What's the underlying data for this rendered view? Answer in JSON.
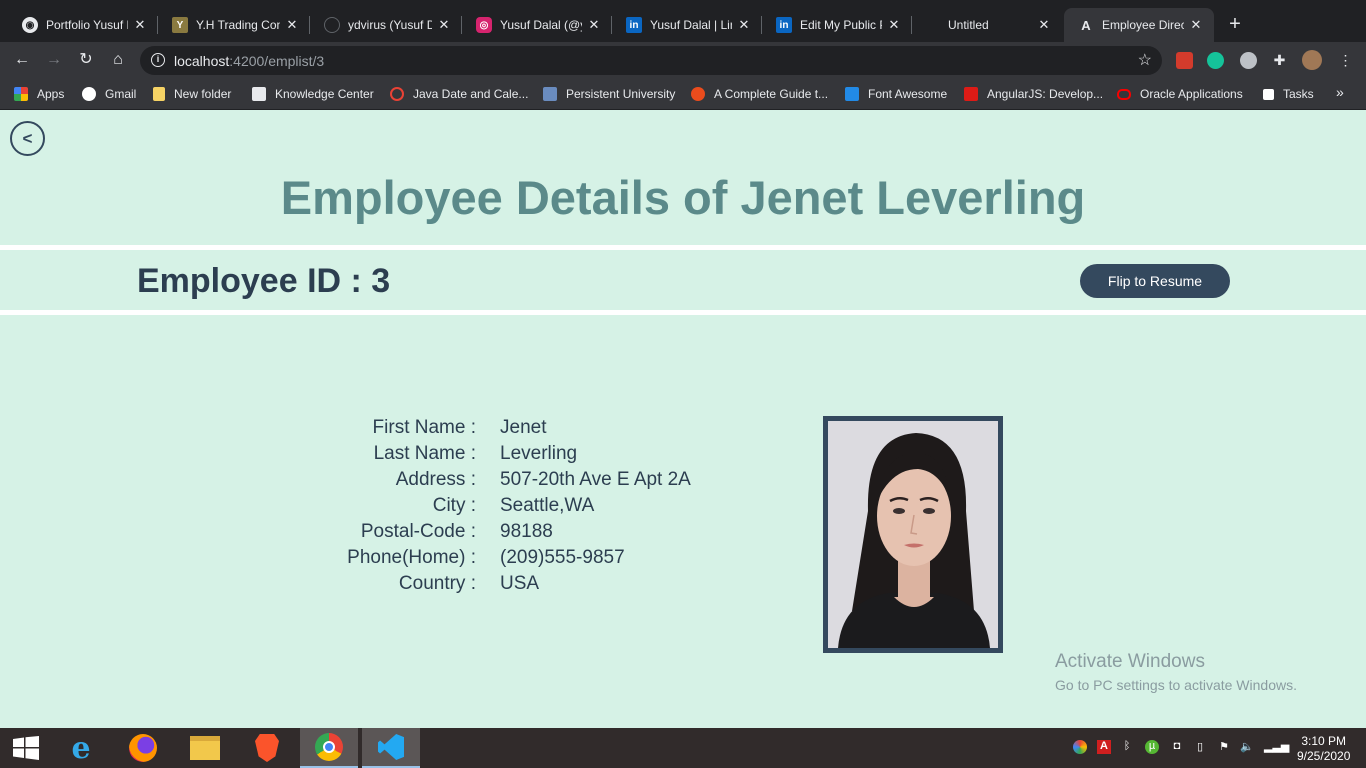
{
  "browser": {
    "tabs": [
      {
        "title": "Portfolio Yusuf D",
        "icon": "globe-icon",
        "color": "#ffffff"
      },
      {
        "title": "Y.H Trading Con",
        "icon": "yh-trading-icon",
        "color": "#c8a040"
      },
      {
        "title": "ydvirus (Yusuf D",
        "icon": "github-icon",
        "color": "#202124"
      },
      {
        "title": "Yusuf Dalal (@yc",
        "icon": "instagram-icon",
        "color": "#d6246e"
      },
      {
        "title": "Yusuf Dalal | Lin",
        "icon": "linkedin-icon",
        "color": "#0a66c2"
      },
      {
        "title": "Edit My Public P",
        "icon": "linkedin-icon",
        "color": "#0a66c2"
      },
      {
        "title": "Untitled",
        "icon": "",
        "color": ""
      },
      {
        "title": "Employee Direct",
        "icon": "angular-icon",
        "color": "#202124"
      }
    ],
    "url_host": "localhost",
    "url_path": ":4200/emplist/3",
    "bookmarks": [
      {
        "label": "Apps",
        "icon": "apps-grid-icon",
        "color": "#e94235"
      },
      {
        "label": "Gmail",
        "icon": "globe-icon",
        "color": "#ffffff"
      },
      {
        "label": "New folder",
        "icon": "folder-icon",
        "color": "#f6d365"
      },
      {
        "label": "Knowledge Center",
        "icon": "document-icon",
        "color": "#ffffff"
      },
      {
        "label": "Java Date and Cale...",
        "icon": "code-icon",
        "color": "#e94235"
      },
      {
        "label": "Persistent University",
        "icon": "persistent-icon",
        "color": "#6a8cbf"
      },
      {
        "label": "A Complete Guide t...",
        "icon": "css-tricks-icon",
        "color": "#ea4c1d"
      },
      {
        "label": "Font Awesome",
        "icon": "flag-icon",
        "color": "#228ae6"
      },
      {
        "label": "AngularJS: Develop...",
        "icon": "angular-icon",
        "color": "#dd1b16"
      },
      {
        "label": "Oracle Applications",
        "icon": "oracle-icon",
        "color": "#f80000"
      },
      {
        "label": "Tasks",
        "icon": "tasks-icon",
        "color": "#ffffff"
      }
    ],
    "bookmarks_more": "»"
  },
  "page": {
    "back_label": "<",
    "title": "Employee Details of Jenet Leverling",
    "employee_id_text": "Employee ID : 3",
    "flip_button": "Flip to Resume",
    "fields": [
      {
        "label": "First Name :",
        "value": "Jenet"
      },
      {
        "label": "Last Name :",
        "value": "Leverling"
      },
      {
        "label": "Address :",
        "value": "507-20th Ave E Apt 2A"
      },
      {
        "label": "City :",
        "value": "Seattle,WA"
      },
      {
        "label": "Postal-Code :",
        "value": "98188"
      },
      {
        "label": "Phone(Home) :",
        "value": "(209)555-9857"
      },
      {
        "label": "Country :",
        "value": "USA"
      }
    ],
    "accent_color": "#34495e",
    "title_color": "#5b8a8a",
    "background_color": "#d6f2e6"
  },
  "watermark": {
    "line1": "Activate Windows",
    "line2": "Go to PC settings to activate Windows."
  },
  "taskbar": {
    "time": "3:10 PM",
    "date": "9/25/2020"
  }
}
